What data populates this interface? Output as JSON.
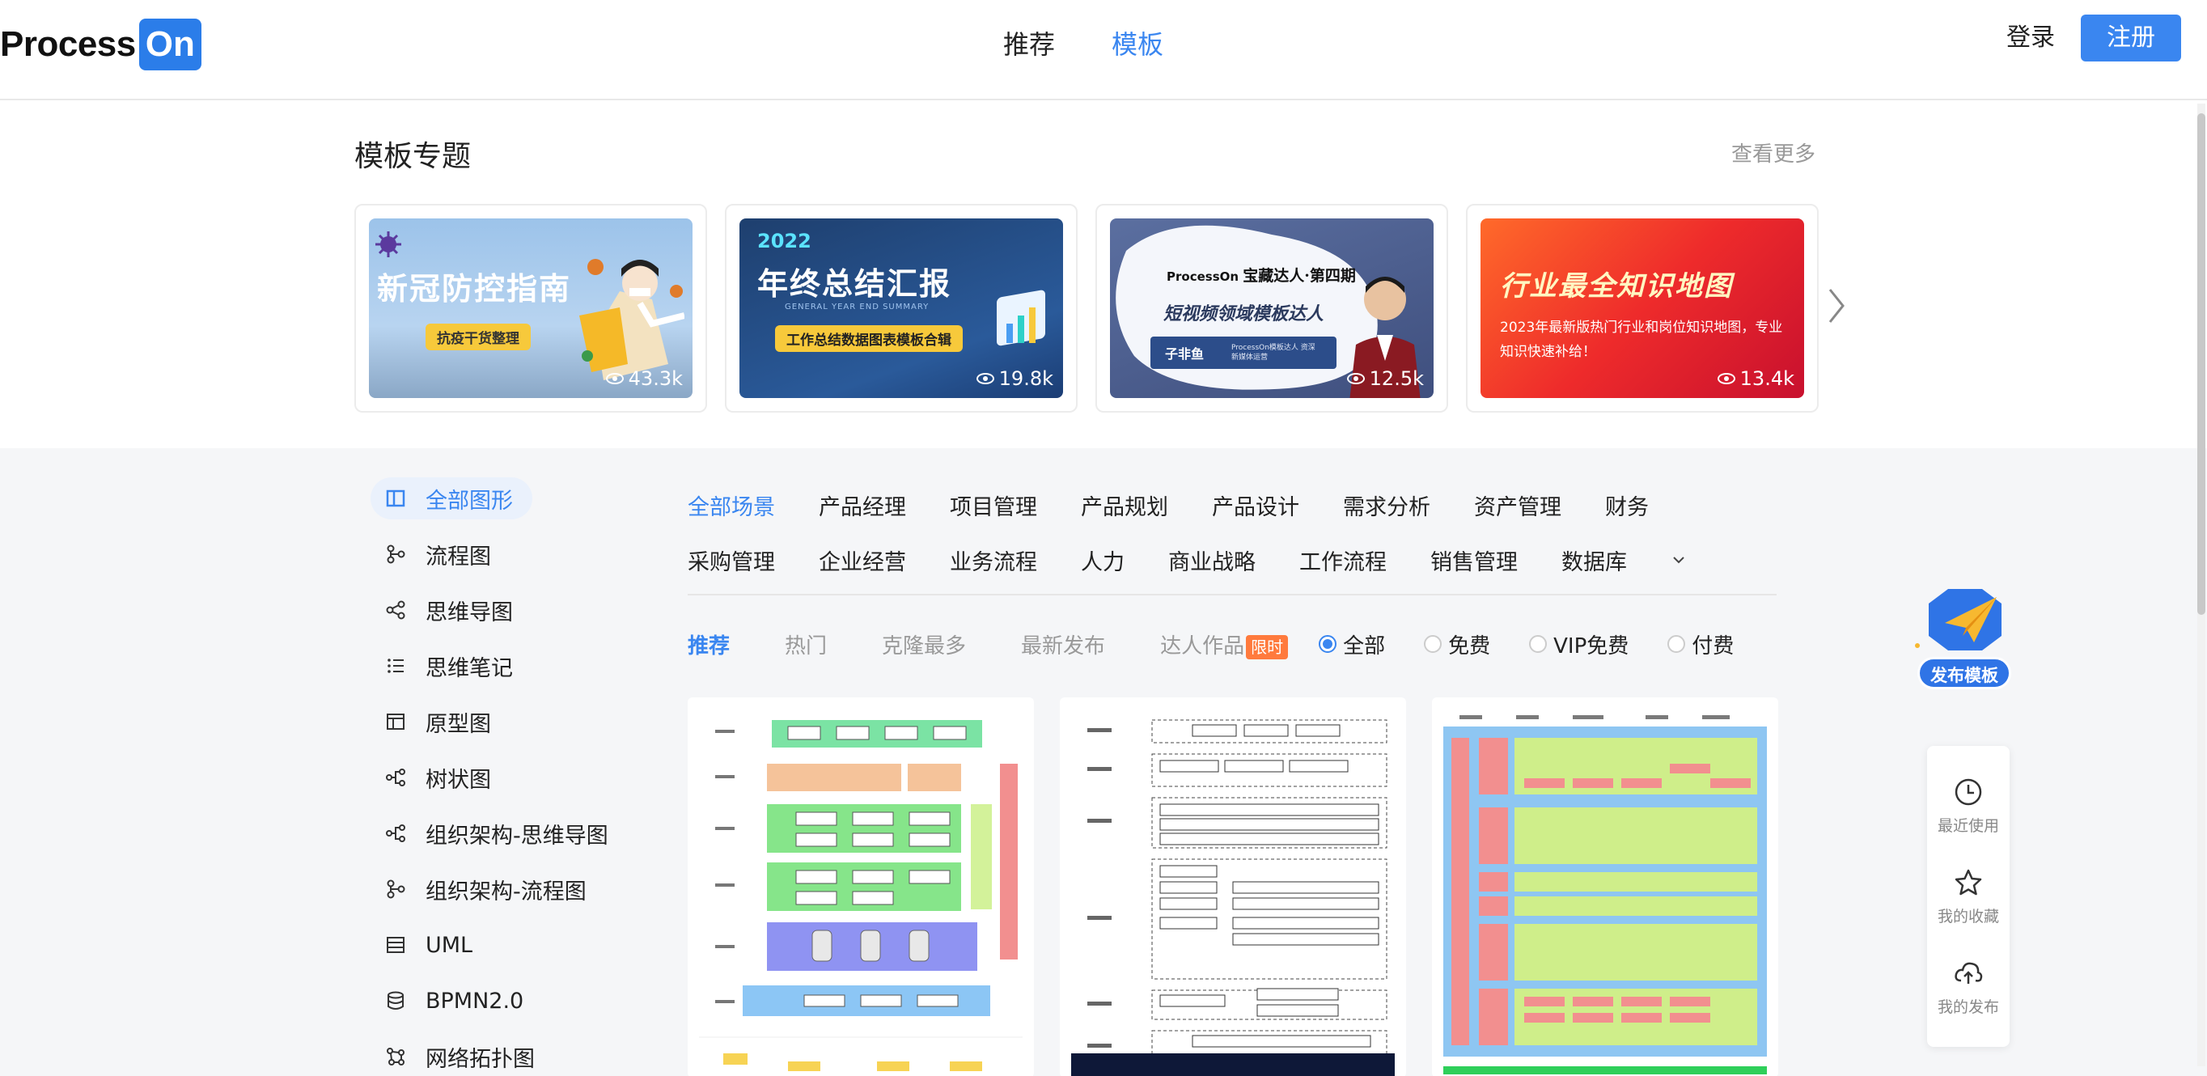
{
  "header": {
    "logo_text": "Process",
    "logo_on": "On",
    "nav": [
      {
        "label": "推荐",
        "active": false
      },
      {
        "label": "模板",
        "active": true
      }
    ],
    "login_label": "登录",
    "register_label": "注册"
  },
  "topics": {
    "title": "模板专题",
    "view_more": "查看更多",
    "cards": [
      {
        "title": "新冠防控指南",
        "subtitle": "抗疫干货整理",
        "views": "43.3k"
      },
      {
        "year": "2022",
        "title": "年终总结汇报",
        "tagline": "GENERAL YEAR END SUMMARY",
        "subtitle": "工作总结数据图表模板合辑",
        "views": "19.8k"
      },
      {
        "brand": "ProcessOn",
        "title": "宝藏达人·第四期",
        "subtitle": "短视频领域模板达人",
        "person": "子非鱼",
        "person_desc": "ProcessOn模板达人 资深新媒体运营",
        "views": "12.5k"
      },
      {
        "title": "行业最全知识地图",
        "desc": "2023年最新版热门行业和岗位知识地图，专业知识快速补给！",
        "views": "13.4k"
      }
    ]
  },
  "sidebar": {
    "items": [
      {
        "label": "全部图形",
        "icon": "all-shapes-icon",
        "active": true
      },
      {
        "label": "流程图",
        "icon": "flowchart-icon",
        "active": false
      },
      {
        "label": "思维导图",
        "icon": "mindmap-icon",
        "active": false
      },
      {
        "label": "思维笔记",
        "icon": "list-icon",
        "active": false
      },
      {
        "label": "原型图",
        "icon": "prototype-icon",
        "active": false
      },
      {
        "label": "树状图",
        "icon": "tree-icon",
        "active": false
      },
      {
        "label": "组织架构-思维导图",
        "icon": "org-mindmap-icon",
        "active": false
      },
      {
        "label": "组织架构-流程图",
        "icon": "org-flowchart-icon",
        "active": false
      },
      {
        "label": "UML",
        "icon": "uml-icon",
        "active": false
      },
      {
        "label": "BPMN2.0",
        "icon": "database-icon",
        "active": false
      },
      {
        "label": "网络拓扑图",
        "icon": "network-icon",
        "active": false
      }
    ]
  },
  "categories": {
    "row1": [
      "全部场景",
      "产品经理",
      "项目管理",
      "产品规划",
      "产品设计",
      "需求分析",
      "资产管理",
      "财务"
    ],
    "row2": [
      "采购管理",
      "企业经营",
      "业务流程",
      "人力",
      "商业战略",
      "工作流程",
      "销售管理",
      "数据库"
    ],
    "active": "全部场景"
  },
  "sort": {
    "items": [
      "推荐",
      "热门",
      "克隆最多",
      "最新发布",
      "达人作品"
    ],
    "active": "推荐",
    "limited_badge": "限时"
  },
  "filters": {
    "items": [
      "全部",
      "免费",
      "VIP免费",
      "付费"
    ],
    "selected": "全部"
  },
  "publish": {
    "label": "发布模板"
  },
  "tools": [
    {
      "label": "最近使用",
      "icon": "clock-icon"
    },
    {
      "label": "我的收藏",
      "icon": "star-icon"
    },
    {
      "label": "我的发布",
      "icon": "cloud-upload-icon"
    }
  ],
  "colors": {
    "accent": "#3a86f0",
    "limited": "#ff7a3d"
  }
}
